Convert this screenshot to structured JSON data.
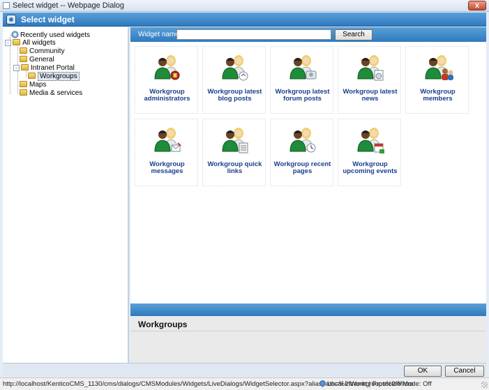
{
  "window": {
    "title": "Select widget -- Webpage Dialog",
    "close_glyph": "x"
  },
  "header": {
    "title": "Select widget"
  },
  "tree": {
    "items": [
      {
        "label": "Recently used widgets",
        "icon": "recent-widgets-icon"
      },
      {
        "label": "All widgets",
        "icon": "folder-icon",
        "expander": "-"
      },
      {
        "label": "Community",
        "icon": "folder-icon"
      },
      {
        "label": "General",
        "icon": "folder-icon"
      },
      {
        "label": "Intranet Portal",
        "icon": "folder-icon",
        "expander": "-"
      },
      {
        "label": "Workgroups",
        "icon": "folder-icon",
        "selected": true
      },
      {
        "label": "Maps",
        "icon": "folder-icon"
      },
      {
        "label": "Media & services",
        "icon": "folder-icon"
      }
    ]
  },
  "filter": {
    "label": "Widget name:",
    "value": "",
    "search_label": "Search"
  },
  "widgets": [
    {
      "name": "Workgroup administrators",
      "badge": "admin"
    },
    {
      "name": "Workgroup latest blog posts",
      "badge": "blog"
    },
    {
      "name": "Workgroup latest forum posts",
      "badge": "forum"
    },
    {
      "name": "Workgroup latest news",
      "badge": "news"
    },
    {
      "name": "Workgroup members",
      "badge": "members"
    },
    {
      "name": "Workgroup messages",
      "badge": "messages"
    },
    {
      "name": "Workgroup quick links",
      "badge": "links"
    },
    {
      "name": "Workgroup recent pages",
      "badge": "pages"
    },
    {
      "name": "Workgroup upcoming events",
      "badge": "events"
    }
  ],
  "description": {
    "title": "Workgroups"
  },
  "buttons": {
    "ok": "OK",
    "cancel": "Cancel"
  },
  "statusbar": {
    "url": "http://localhost/KenticoCMS_1130/cms/dialogs/CMSModules/Widgets/LiveDialogs/WidgetSelector.aspx?aliaspath=%2fWorkgroups%2fMicro",
    "zone": "Local intranet | Protected Mode: Off"
  },
  "colors": {
    "accent": "#2f79bf",
    "link": "#1b3f8b",
    "shirt": "#1e8c3a"
  }
}
